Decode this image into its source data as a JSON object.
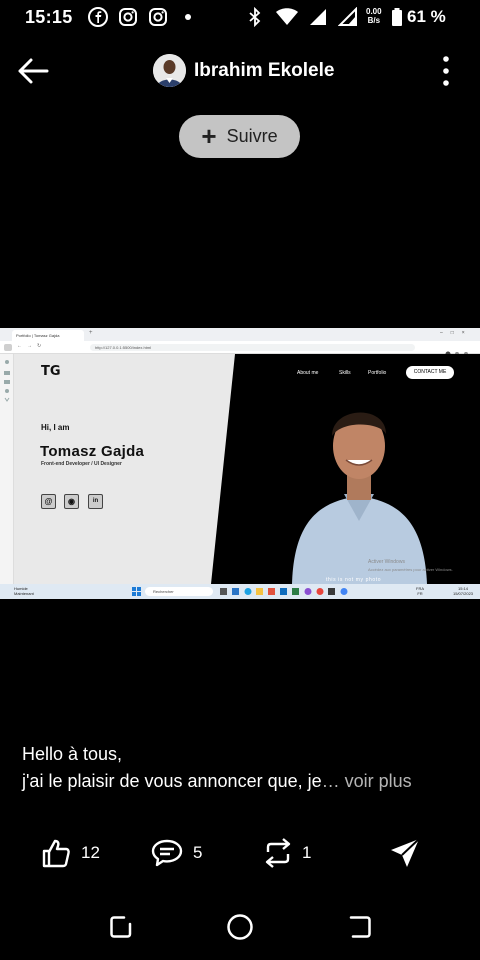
{
  "status_bar": {
    "time": "15:15",
    "net_rate_value": "0.00",
    "net_rate_unit": "B/s",
    "battery": "61 %",
    "icons": [
      "facebook-icon",
      "instagram-icon",
      "instagram-icon",
      "notification-dot-icon",
      "bluetooth-icon",
      "wifi-icon",
      "signal-icon",
      "signal-icon",
      "battery-icon"
    ]
  },
  "header": {
    "user_name": "Ibrahim Ekolele",
    "follow_label": "Suivre"
  },
  "screenshot": {
    "tab_title": "Portfolio | Tomasz Gajda",
    "url": "http://127.0.0.1:5500/index.html",
    "logo": "TG",
    "greeting": "Hi, I am",
    "name": "Tomasz Gajda",
    "role": "Front-end Developer / UI Designer",
    "nav": [
      "About me",
      "Skills",
      "Portfolio"
    ],
    "contact": "CONTACT ME",
    "watermark_title": "Activer Windows",
    "watermark_sub": "Accédez aux paramètres pour activer Windows.",
    "caption": "this is not my photo",
    "taskbar": {
      "weather_label": "Humide",
      "weather_sub": "Maintenant",
      "search": "Rechercher",
      "lang": "FRA",
      "lang_sub": "FR",
      "time": "15:14",
      "date": "15/07/2023"
    }
  },
  "post": {
    "line1": "Hello à tous,",
    "line2": "j'ai le plaisir de vous annoncer que, je",
    "ellipsis": "…",
    "see_more": "voir plus"
  },
  "actions": {
    "likes": "12",
    "comments": "5",
    "reposts": "1"
  }
}
